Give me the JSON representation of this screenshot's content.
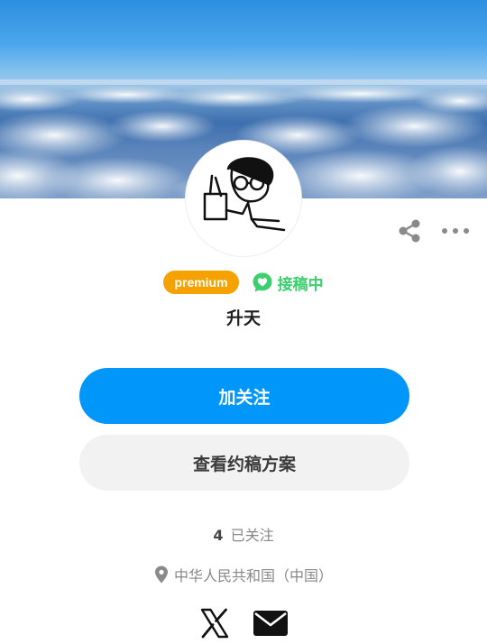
{
  "profile": {
    "badge_premium": "premium",
    "badge_request": "接稿中",
    "name": "升天"
  },
  "actions": {
    "follow_label": "加关注",
    "plan_label": "查看约稿方案"
  },
  "stats": {
    "following_count": "4",
    "following_label": "已关注"
  },
  "location": {
    "text": "中华人民共和国（中国）"
  },
  "icons": {
    "share": "share-icon",
    "more": "more-icon",
    "request": "heart-chat-icon",
    "location": "location-pin-icon",
    "x": "x-logo-icon",
    "mail": "mail-icon"
  },
  "colors": {
    "accent": "#0096fa",
    "premium": "#f5a100",
    "request": "#3ccf6e"
  }
}
